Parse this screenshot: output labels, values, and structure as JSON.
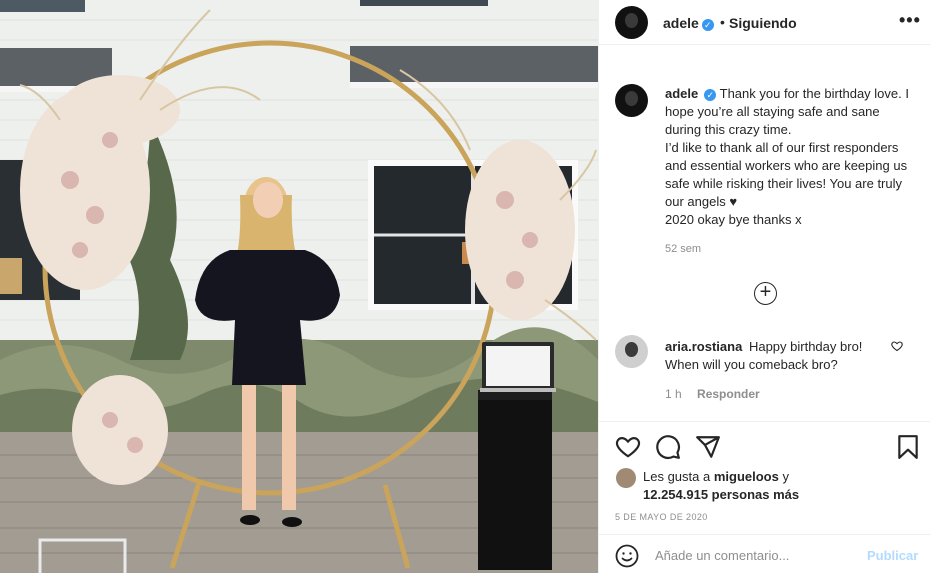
{
  "post": {
    "username": "adele",
    "verified_mark": "✓",
    "separator": "•",
    "follow_status": "Siguiendo",
    "more_label": "•••"
  },
  "caption": {
    "username": "adele",
    "lines": [
      "Thank you for the birthday love. I hope you’re all staying safe and sane during this crazy time.",
      "I’d like to thank all of our first responders and essential workers who are keeping us safe while risking their lives! You are truly our angels ♥",
      "2020 okay bye thanks x"
    ],
    "age": "52 sem"
  },
  "load_more": {
    "icon": "plus-circle-icon",
    "label": "+"
  },
  "comments": [
    {
      "username": "aria.rostiana",
      "text": "Happy birthday bro! When will you comeback bro?",
      "age": "1 h",
      "reply_label": "Responder",
      "like_icon": "heart-outline-icon"
    }
  ],
  "likes": {
    "prefix": "Les gusta a",
    "user": "migueloos",
    "conjunction": "y",
    "count_text": "12.254.915 personas más"
  },
  "date": "5 DE MAYO DE 2020",
  "comment_box": {
    "placeholder": "Añade un comentario...",
    "publish_label": "Publicar"
  },
  "colors": {
    "verified": "#3897f0",
    "publish_disabled": "#b3dbff",
    "muted_text": "#8e8e8e"
  }
}
